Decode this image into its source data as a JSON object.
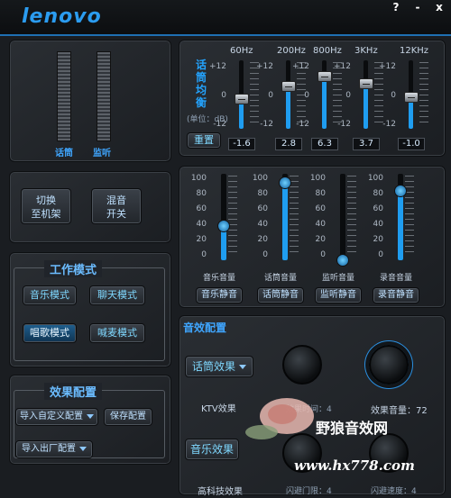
{
  "window": {
    "logo": "lenovo",
    "help_btn": "?",
    "min_btn": "-",
    "close_btn": "x"
  },
  "left": {
    "vu_labels": [
      "话筒",
      "监听"
    ],
    "mode_buttons": {
      "switch": [
        "切换",
        "至机架"
      ],
      "mix": [
        "混音",
        "开关"
      ]
    },
    "work_mode": {
      "title": "工作模式",
      "items": [
        "音乐模式",
        "聊天模式",
        "唱歌模式",
        "喊麦模式"
      ],
      "active": "唱歌模式"
    },
    "effect_config": {
      "title": "效果配置",
      "import_custom": "导入自定义配置",
      "save": "保存配置",
      "import_factory": "导入出厂配置"
    }
  },
  "eq": {
    "title": [
      "话",
      "筒",
      "均",
      "衡"
    ],
    "unit": "(单位：dB)",
    "reset": "重置",
    "scale": [
      "+12",
      "0",
      "-12"
    ],
    "bands": [
      {
        "freq": "60Hz",
        "value": "-1.6"
      },
      {
        "freq": "200Hz",
        "value": "2.8"
      },
      {
        "freq": "800Hz",
        "value": "6.3"
      },
      {
        "freq": "3KHz",
        "value": "3.7"
      },
      {
        "freq": "12KHz",
        "value": "-1.0"
      }
    ]
  },
  "mixer": {
    "scale": [
      "100",
      "80",
      "60",
      "40",
      "20",
      "0"
    ],
    "channels": [
      {
        "label": "音乐音量",
        "mute": "音乐静音",
        "level": 40
      },
      {
        "label": "话筒音量",
        "mute": "话筒静音",
        "level": 90
      },
      {
        "label": "监听音量",
        "mute": "监听静音",
        "level": 0
      },
      {
        "label": "录音音量",
        "mute": "录音静音",
        "level": 80
      }
    ]
  },
  "sound": {
    "title": "音效配置",
    "mic_effect_btn": "话筒效果",
    "ktv_label": "KTV效果",
    "delay_label": "效果时间：4",
    "volume_label": "效果音量：72",
    "music_effect_btn": "音乐效果",
    "hitech_label": "高科技效果",
    "gate_label": "闪避门限：4",
    "speed_label": "闪避速度：4"
  },
  "watermark": {
    "site": "野狼音效网",
    "url": "www.hx778.com"
  },
  "colors": {
    "accent": "#2b9cf0",
    "panel": "#1b1e22"
  }
}
